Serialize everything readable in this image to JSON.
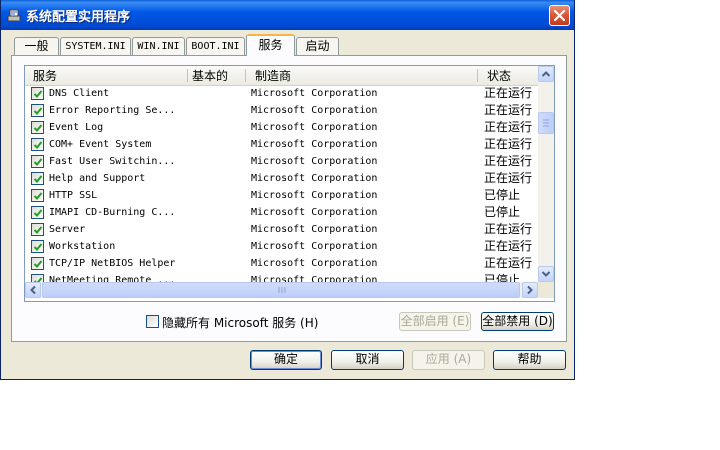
{
  "window": {
    "title": "系统配置实用程序",
    "close_icon": "close-icon"
  },
  "tabs": [
    {
      "label": "一般",
      "active": false
    },
    {
      "label": "SYSTEM.INI",
      "active": false
    },
    {
      "label": "WIN.INI",
      "active": false
    },
    {
      "label": "BOOT.INI",
      "active": false
    },
    {
      "label": "服务",
      "active": true
    },
    {
      "label": "启动",
      "active": false
    }
  ],
  "list": {
    "columns": [
      "服务",
      "基本的",
      "制造商",
      "状态"
    ],
    "rows": [
      {
        "checked": true,
        "service": "DNS Client",
        "essential": "",
        "manufacturer": "Microsoft Corporation",
        "status": "正在运行"
      },
      {
        "checked": true,
        "service": "Error Reporting Se...",
        "essential": "",
        "manufacturer": "Microsoft Corporation",
        "status": "正在运行"
      },
      {
        "checked": true,
        "service": "Event Log",
        "essential": "",
        "manufacturer": "Microsoft Corporation",
        "status": "正在运行"
      },
      {
        "checked": true,
        "service": "COM+ Event System",
        "essential": "",
        "manufacturer": "Microsoft Corporation",
        "status": "正在运行"
      },
      {
        "checked": true,
        "service": "Fast User Switchin...",
        "essential": "",
        "manufacturer": "Microsoft Corporation",
        "status": "正在运行"
      },
      {
        "checked": true,
        "service": "Help and Support",
        "essential": "",
        "manufacturer": "Microsoft Corporation",
        "status": "正在运行"
      },
      {
        "checked": true,
        "service": "HTTP SSL",
        "essential": "",
        "manufacturer": "Microsoft Corporation",
        "status": "已停止"
      },
      {
        "checked": true,
        "service": "IMAPI CD-Burning C...",
        "essential": "",
        "manufacturer": "Microsoft Corporation",
        "status": "已停止"
      },
      {
        "checked": true,
        "service": "Server",
        "essential": "",
        "manufacturer": "Microsoft Corporation",
        "status": "正在运行"
      },
      {
        "checked": true,
        "service": "Workstation",
        "essential": "",
        "manufacturer": "Microsoft Corporation",
        "status": "正在运行"
      },
      {
        "checked": true,
        "service": "TCP/IP NetBIOS Helper",
        "essential": "",
        "manufacturer": "Microsoft Corporation",
        "status": "正在运行"
      },
      {
        "checked": true,
        "service": "NetMeeting Remote ...",
        "essential": "",
        "manufacturer": "Microsoft Corporation",
        "status": "已停止"
      }
    ]
  },
  "hide_ms": {
    "checked": false,
    "label": "隐藏所有 Microsoft 服务 (H)"
  },
  "panel_buttons": {
    "enable_all": "全部启用 (E)",
    "disable_all": "全部禁用 (D)"
  },
  "dialog_buttons": {
    "ok": "确定",
    "cancel": "取消",
    "apply": "应用 (A)",
    "help": "帮助"
  },
  "colors": {
    "titlebar": "#0058e6",
    "dialog_bg": "#ece9d8",
    "active_tab_accent": "#f7b44a",
    "checkbox_check": "#21a121"
  }
}
